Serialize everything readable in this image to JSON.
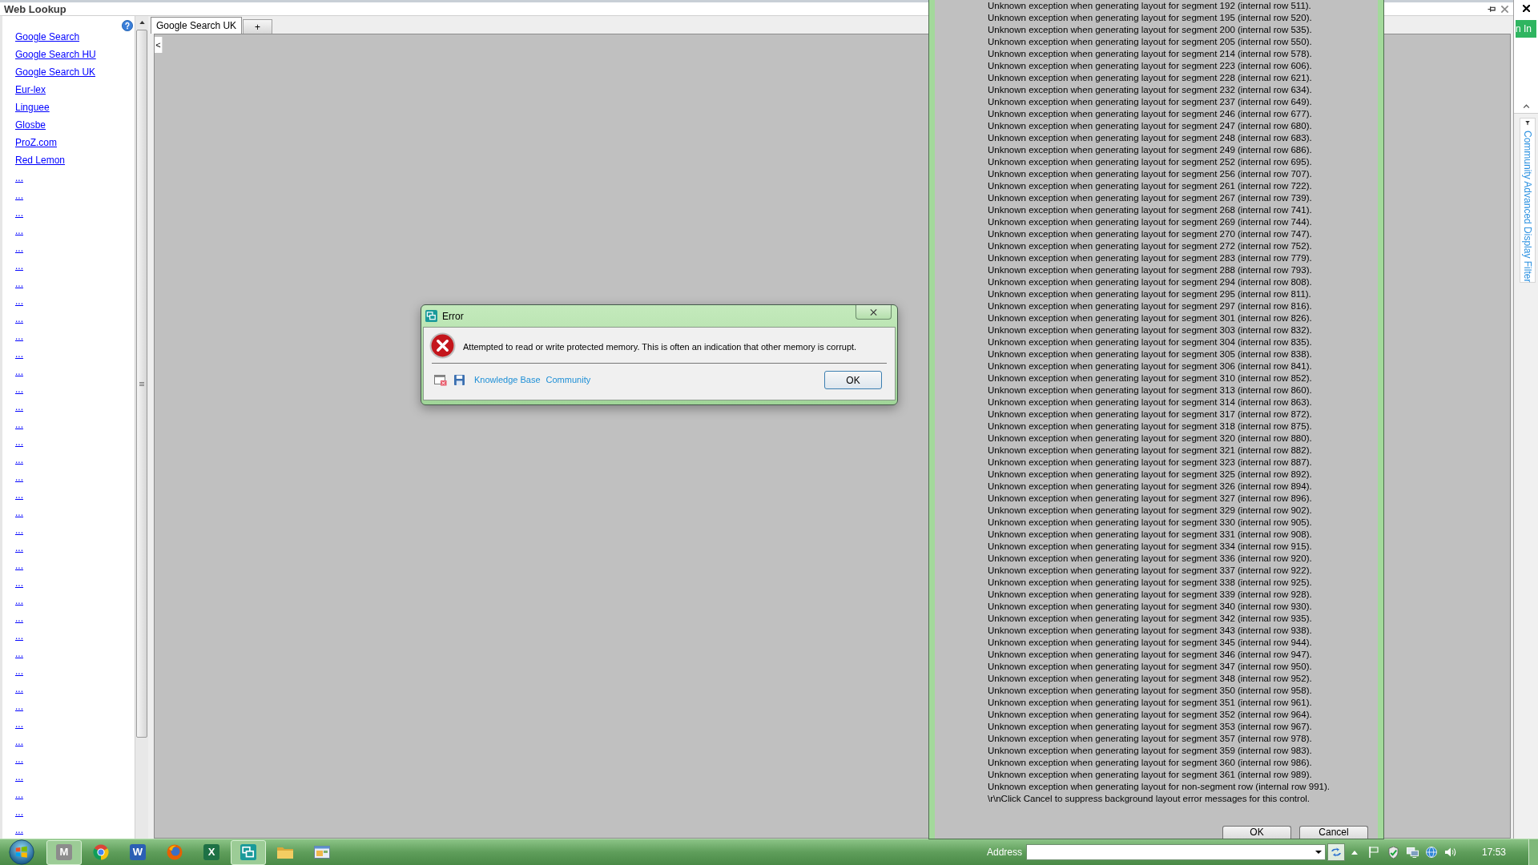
{
  "web_lookup": {
    "title": "Web Lookup",
    "links": [
      "Google Search",
      "Google Search HU",
      "Google Search UK",
      "Eur-lex",
      "Linguee",
      "Glosbe",
      "ProZ.com",
      "Red Lemon",
      "...",
      "...",
      "...",
      "...",
      "...",
      "...",
      "...",
      "...",
      "...",
      "...",
      "...",
      "...",
      "...",
      "...",
      "...",
      "...",
      "...",
      "...",
      "...",
      "...",
      "...",
      "...",
      "...",
      "...",
      "...",
      "...",
      "...",
      "...",
      "...",
      "...",
      "...",
      "...",
      "...",
      "...",
      "...",
      "...",
      "...",
      "..."
    ],
    "tabs": [
      {
        "label": "Google Search UK",
        "selected": true
      },
      {
        "label": "+",
        "selected": false
      }
    ],
    "collapse_button": "<"
  },
  "side_strip": {
    "sign_in_button": "n In",
    "filter_tab": "Community Advanced Display Filter"
  },
  "message_window": {
    "lines": [
      "Unknown exception when generating layout for segment 192 (internal row 511).",
      "Unknown exception when generating layout for segment 195 (internal row 520).",
      "Unknown exception when generating layout for segment 200 (internal row 535).",
      "Unknown exception when generating layout for segment 205 (internal row 550).",
      "Unknown exception when generating layout for segment 214 (internal row 578).",
      "Unknown exception when generating layout for segment 223 (internal row 606).",
      "Unknown exception when generating layout for segment 228 (internal row 621).",
      "Unknown exception when generating layout for segment 232 (internal row 634).",
      "Unknown exception when generating layout for segment 237 (internal row 649).",
      "Unknown exception when generating layout for segment 246 (internal row 677).",
      "Unknown exception when generating layout for segment 247 (internal row 680).",
      "Unknown exception when generating layout for segment 248 (internal row 683).",
      "Unknown exception when generating layout for segment 249 (internal row 686).",
      "Unknown exception when generating layout for segment 252 (internal row 695).",
      "Unknown exception when generating layout for segment 256 (internal row 707).",
      "Unknown exception when generating layout for segment 261 (internal row 722).",
      "Unknown exception when generating layout for segment 267 (internal row 739).",
      "Unknown exception when generating layout for segment 268 (internal row 741).",
      "Unknown exception when generating layout for segment 269 (internal row 744).",
      "Unknown exception when generating layout for segment 270 (internal row 747).",
      "Unknown exception when generating layout for segment 272 (internal row 752).",
      "Unknown exception when generating layout for segment 283 (internal row 779).",
      "Unknown exception when generating layout for segment 288 (internal row 793).",
      "Unknown exception when generating layout for segment 294 (internal row 808).",
      "Unknown exception when generating layout for segment 295 (internal row 811).",
      "Unknown exception when generating layout for segment 297 (internal row 816).",
      "Unknown exception when generating layout for segment 301 (internal row 826).",
      "Unknown exception when generating layout for segment 303 (internal row 832).",
      "Unknown exception when generating layout for segment 304 (internal row 835).",
      "Unknown exception when generating layout for segment 305 (internal row 838).",
      "Unknown exception when generating layout for segment 306 (internal row 841).",
      "Unknown exception when generating layout for segment 310 (internal row 852).",
      "Unknown exception when generating layout for segment 313 (internal row 860).",
      "Unknown exception when generating layout for segment 314 (internal row 863).",
      "Unknown exception when generating layout for segment 317 (internal row 872).",
      "Unknown exception when generating layout for segment 318 (internal row 875).",
      "Unknown exception when generating layout for segment 320 (internal row 880).",
      "Unknown exception when generating layout for segment 321 (internal row 882).",
      "Unknown exception when generating layout for segment 323 (internal row 887).",
      "Unknown exception when generating layout for segment 325 (internal row 892).",
      "Unknown exception when generating layout for segment 326 (internal row 894).",
      "Unknown exception when generating layout for segment 327 (internal row 896).",
      "Unknown exception when generating layout for segment 329 (internal row 902).",
      "Unknown exception when generating layout for segment 330 (internal row 905).",
      "Unknown exception when generating layout for segment 331 (internal row 908).",
      "Unknown exception when generating layout for segment 334 (internal row 915).",
      "Unknown exception when generating layout for segment 336 (internal row 920).",
      "Unknown exception when generating layout for segment 337 (internal row 922).",
      "Unknown exception when generating layout for segment 338 (internal row 925).",
      "Unknown exception when generating layout for segment 339 (internal row 928).",
      "Unknown exception when generating layout for segment 340 (internal row 930).",
      "Unknown exception when generating layout for segment 342 (internal row 935).",
      "Unknown exception when generating layout for segment 343 (internal row 938).",
      "Unknown exception when generating layout for segment 345 (internal row 944).",
      "Unknown exception when generating layout for segment 346 (internal row 947).",
      "Unknown exception when generating layout for segment 347 (internal row 950).",
      "Unknown exception when generating layout for segment 348 (internal row 952).",
      "Unknown exception when generating layout for segment 350 (internal row 958).",
      "Unknown exception when generating layout for segment 351 (internal row 961).",
      "Unknown exception when generating layout for segment 352 (internal row 964).",
      "Unknown exception when generating layout for segment 353 (internal row 967).",
      "Unknown exception when generating layout for segment 357 (internal row 978).",
      "Unknown exception when generating layout for segment 359 (internal row 983).",
      "Unknown exception when generating layout for segment 360 (internal row 986).",
      "Unknown exception when generating layout for segment 361 (internal row 989).",
      "Unknown exception when generating layout for non-segment row (internal row 991).",
      "\\r\\nClick Cancel to suppress background layout error messages for this control."
    ],
    "buttons": [
      "OK",
      "Cancel"
    ]
  },
  "error_dialog": {
    "title": "Error",
    "message": "Attempted to read or write protected memory. This is often an indication that other memory is corrupt.",
    "links": [
      "Knowledge Base",
      "Community"
    ],
    "button": "OK"
  },
  "taskbar": {
    "apps": [
      {
        "kind": "tile",
        "glyph": "M",
        "color": "#8c8c8c",
        "active": true
      },
      {
        "kind": "chrome",
        "active": false
      },
      {
        "kind": "tile",
        "glyph": "W",
        "color": "#2b5fb4",
        "active": false
      },
      {
        "kind": "firefox",
        "active": false
      },
      {
        "kind": "tile",
        "glyph": "X",
        "color": "#1e7145",
        "active": false
      },
      {
        "kind": "chat",
        "active": true
      },
      {
        "kind": "folder",
        "active": false
      },
      {
        "kind": "window",
        "active": false
      }
    ],
    "address_label": "Address",
    "clock": "17:53"
  }
}
